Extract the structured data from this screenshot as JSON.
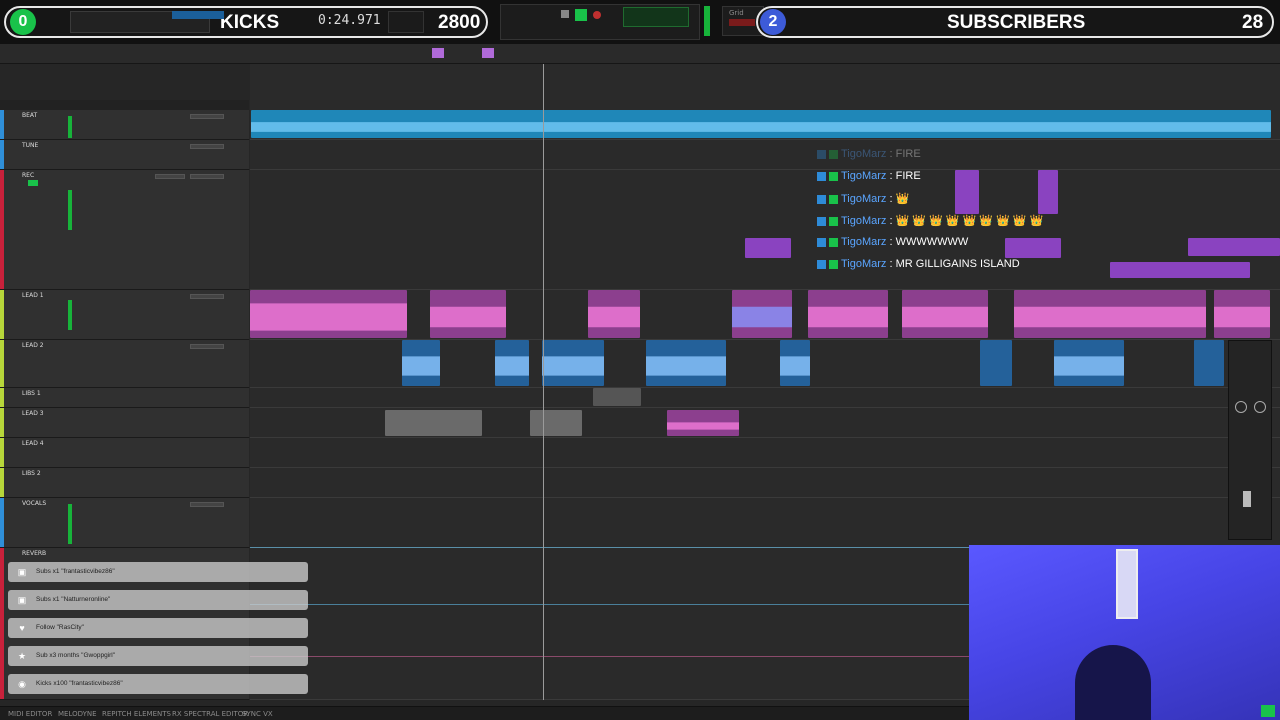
{
  "topbar": {
    "kicks_count": "0",
    "kicks_label": "KICKS",
    "counter_time": "0:24.971",
    "kicks_goal": "2800",
    "subs_count": "2",
    "subs_label": "SUBSCRIBERS",
    "subs_goal": "28",
    "colors": {
      "kicks_green": "#19c24a",
      "subs_blue": "#3d5bd8",
      "meter_green": "#17b33a"
    }
  },
  "tracks": [
    {
      "name": "BEAT",
      "color": "#2f8fd8"
    },
    {
      "name": "TUNE",
      "color": "#2f8fd8"
    },
    {
      "name": "REC",
      "color": "#c8213b"
    },
    {
      "name": "LEAD 1",
      "color": "#b6d63a"
    },
    {
      "name": "LEAD 2",
      "color": "#b6d63a"
    },
    {
      "name": "LIBS 1",
      "color": "#b6d63a"
    },
    {
      "name": "LEAD 3",
      "color": "#b6d63a"
    },
    {
      "name": "LEAD 4",
      "color": "#b6d63a"
    },
    {
      "name": "LIBS 2",
      "color": "#b6d63a"
    },
    {
      "name": "VOCALS",
      "color": "#2f8fd8"
    },
    {
      "name": "REVERB",
      "color": "#c8213b"
    }
  ],
  "chat": [
    {
      "user": "TigoMarz",
      "msg": "FIRE",
      "faded": true
    },
    {
      "user": "TigoMarz",
      "msg": "FIRE",
      "faded": false
    },
    {
      "user": "TigoMarz",
      "msg": "👑",
      "faded": false
    },
    {
      "user": "TigoMarz",
      "msg": "👑 👑 👑 👑 👑 👑 👑 👑 👑",
      "faded": false
    },
    {
      "user": "TigoMarz",
      "msg": "WWWWWWW",
      "faded": false
    },
    {
      "user": "TigoMarz",
      "msg": "MR GILLIGAINS ISLAND",
      "faded": false
    }
  ],
  "alerts": [
    {
      "icon": "gift-icon",
      "text": "Subs x1 \"frantasticvibez86\""
    },
    {
      "icon": "gift-icon",
      "text": "Subs x1 \"Natturneronline\""
    },
    {
      "icon": "heart-icon",
      "text": "Follow \"RasCity\""
    },
    {
      "icon": "star-icon",
      "text": "Sub x3 months \"Gwoppgirl\""
    },
    {
      "icon": "circle-icon",
      "text": "Kicks x100 \"frantasticvibez86\""
    }
  ],
  "bottombar": {
    "items": [
      "MIDI EDITOR",
      "MELODYNE",
      "REPITCH ELEMENTS",
      "RX SPECTRAL EDITOR",
      "SYNC VX"
    ]
  }
}
